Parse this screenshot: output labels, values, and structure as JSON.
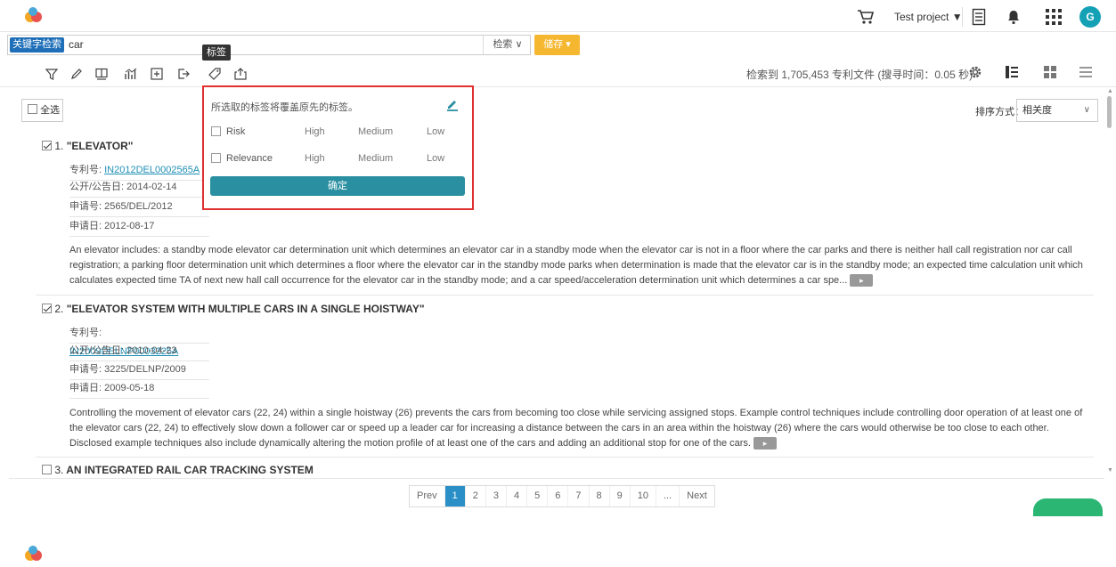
{
  "header": {
    "project_label": "Test project ▼",
    "avatar_initial": "G"
  },
  "search": {
    "mode_tag": "关键字检索",
    "query": "car",
    "search_button": "检索 ∨",
    "save_button": "储存 ▾"
  },
  "toolbar": {
    "tooltip": "标签",
    "icons": [
      "filter-icon",
      "highlight-icon",
      "book-icon",
      "chart-icon",
      "compare-icon",
      "export-icon",
      "tag-icon",
      "share-icon"
    ],
    "result_count": "检索到 1,705,453 专利文件 (搜寻时间：0.05 秒)"
  },
  "list": {
    "select_all": "全选",
    "sort_label": "排序方式：",
    "sort_value": "相关度",
    "patents": [
      {
        "index": "1.",
        "checked": true,
        "title": "\"ELEVATOR\"",
        "patent_no_label": "专利号:",
        "patent_no": "IN2012DEL0002565A",
        "pub_date": "公开/公告日: 2014-02-14",
        "app_no": "申请号: 2565/DEL/2012",
        "app_date": "申请日: 2012-08-17",
        "abstract": "An elevator includes: a standby mode elevator car determination unit which determines an elevator car in a standby mode when the elevator car is not in a floor where the car parks and there is neither hall call registration nor car call registration; a parking floor determination unit which determines a floor where the elevator car in the standby mode parks when determination is made that the elevator car is in the standby mode; an expected time calculation unit which calculates expected time TA of next new hall call occurrence for the elevator car in the standby mode; and a car speed/acceleration determination unit which determines a car spe..."
      },
      {
        "index": "2.",
        "checked": true,
        "title": "\"ELEVATOR SYSTEM WITH MULTIPLE CARS IN A SINGLE HOISTWAY\"",
        "patent_no_label": "专利号:",
        "patent_no": "IN2009DELNP0003225A",
        "pub_date": "公开/公告日: 2010-04-23",
        "app_no": "申请号: 3225/DELNP/2009",
        "app_date": "申请日: 2009-05-18",
        "abstract": "Controlling the movement of elevator cars (22, 24) within a single hoistway (26) prevents the cars from becoming too close while servicing assigned stops. Example control techniques include controlling door operation of at least one of the elevator cars (22, 24) to effectively slow down a follower car or speed up a leader car for increasing a distance between the cars in an area within the hoistway (26) where the cars would otherwise be too close to each other. Disclosed example techniques also include dynamically altering the motion profile of at least one of the cars and adding an additional stop for one of the cars."
      },
      {
        "index": "3.",
        "checked": false,
        "title": "AN INTEGRATED RAIL CAR TRACKING SYSTEM"
      }
    ]
  },
  "pagination": {
    "prev": "Prev",
    "pages": [
      "1",
      "2",
      "3",
      "4",
      "5",
      "6",
      "7",
      "8",
      "9",
      "10",
      "..."
    ],
    "next": "Next",
    "active_page": "1"
  },
  "label_popup": {
    "title": "所选取的标签将覆盖原先的标签。",
    "rows": [
      {
        "name": "Risk",
        "levels": [
          "High",
          "Medium",
          "Low"
        ]
      },
      {
        "name": "Relevance",
        "levels": [
          "High",
          "Medium",
          "Low"
        ]
      }
    ],
    "confirm": "确定"
  },
  "colors": {
    "accent_teal": "#2a8fa0",
    "save_orange": "#f5b730",
    "popup_border": "#e03030",
    "link": "#1f8fb5"
  }
}
